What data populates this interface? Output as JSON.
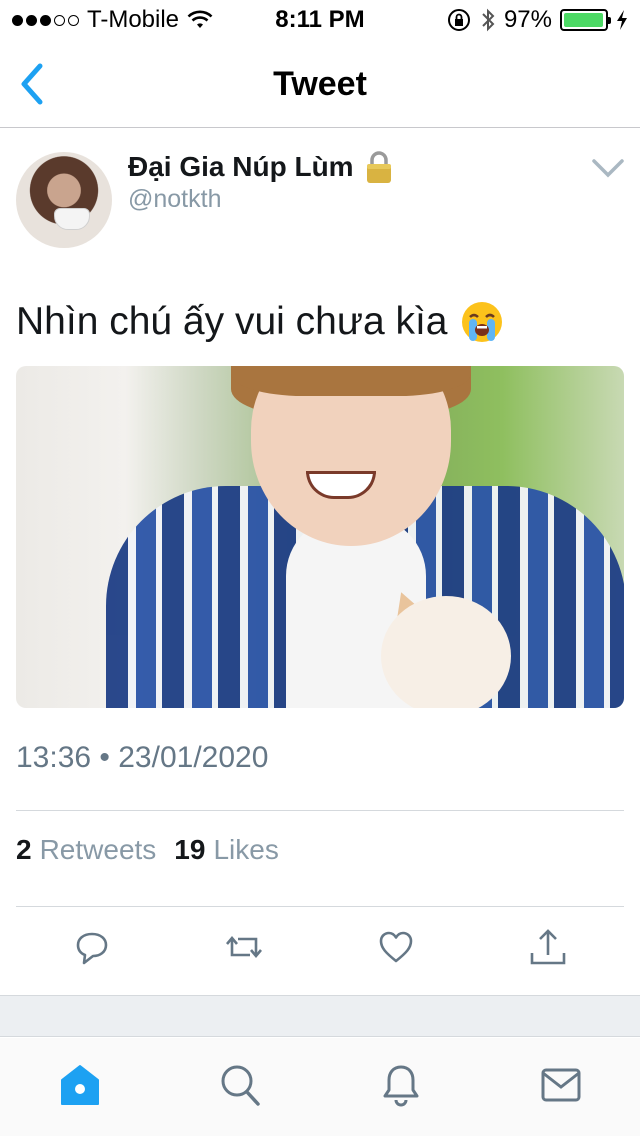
{
  "status_bar": {
    "carrier": "T-Mobile",
    "time": "8:11 PM",
    "battery": "97%",
    "battery_level": 0.97,
    "signal_dots": [
      true,
      true,
      true,
      false,
      false
    ]
  },
  "nav": {
    "title": "Tweet",
    "back_icon": "chevron-left-icon"
  },
  "tweet": {
    "author_name": "Đại Gia Núp Lùm",
    "handle": "@notkth",
    "text": "Nhìn chú ấy vui chưa kìa",
    "timestamp": "13:36 • 23/01/2020",
    "retweets_count": "2",
    "retweets_label": "Retweets",
    "likes_count": "19",
    "likes_label": "Likes"
  },
  "actions": [
    "reply-icon",
    "retweet-icon",
    "like-icon",
    "share-icon"
  ],
  "tab_bar": [
    "home-icon",
    "search-icon",
    "notifications-icon",
    "messages-icon"
  ],
  "colors": {
    "accent": "#1da1f2",
    "back_blue": "#1da1f2",
    "secondary_text": "#8899a6",
    "battery_green": "#4cd964"
  }
}
